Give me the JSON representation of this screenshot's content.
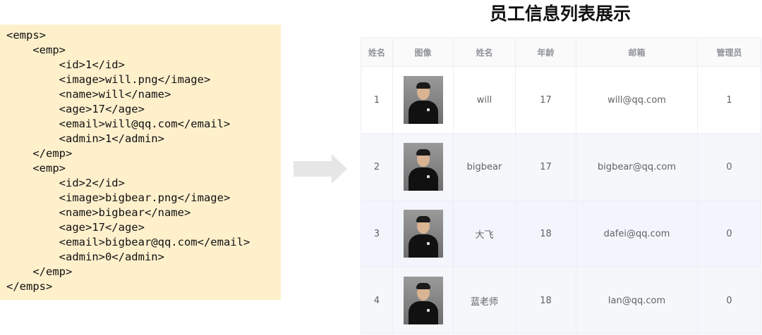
{
  "title": "员工信息列表展示",
  "code": [
    "<emps>",
    "    <emp>",
    "        <id>1</id>",
    "        <image>will.png</image>",
    "        <name>will</name>",
    "        <age>17</age>",
    "        <email>will@qq.com</email>",
    "        <admin>1</admin>",
    "    </emp>",
    "    <emp>",
    "        <id>2</id>",
    "        <image>bigbear.png</image>",
    "        <name>bigbear</name>",
    "        <age>17</age>",
    "        <email>bigbear@qq.com</email>",
    "        <admin>0</admin>",
    "    </emp>",
    "</emps>"
  ],
  "table": {
    "headers": [
      "姓名",
      "图像",
      "姓名",
      "年龄",
      "邮箱",
      "管理员"
    ],
    "rows": [
      {
        "id": "1",
        "name": "will",
        "age": "17",
        "email": "will@qq.com",
        "admin": "1"
      },
      {
        "id": "2",
        "name": "bigbear",
        "age": "17",
        "email": "bigbear@qq.com",
        "admin": "0"
      },
      {
        "id": "3",
        "name": "大飞",
        "age": "18",
        "email": "dafei@qq.com",
        "admin": "0"
      },
      {
        "id": "4",
        "name": "蓝老师",
        "age": "18",
        "email": "lan@qq.com",
        "admin": "0"
      }
    ]
  }
}
